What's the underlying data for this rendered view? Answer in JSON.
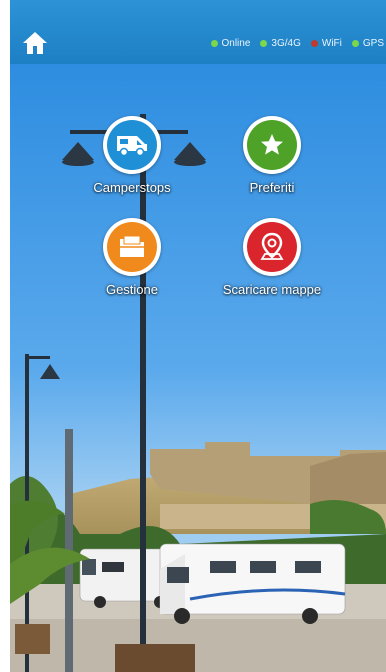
{
  "header": {
    "status": [
      {
        "label": "Online",
        "color": "#7ad84a"
      },
      {
        "label": "3G/4G",
        "color": "#7ad84a"
      },
      {
        "label": "WiFi",
        "color": "#c0392b"
      },
      {
        "label": "GPS",
        "color": "#7ad84a"
      }
    ]
  },
  "menu": {
    "camperstops": {
      "label": "Camperstops",
      "color": "#1f8fd6",
      "icon": "camper-icon"
    },
    "preferiti": {
      "label": "Preferiti",
      "color": "#4ea227",
      "icon": "star-icon"
    },
    "gestione": {
      "label": "Gestione",
      "color": "#f08a1c",
      "icon": "folder-icon"
    },
    "scaricare": {
      "label": "Scaricare mappe",
      "color": "#d9252b",
      "icon": "map-pin-icon"
    }
  }
}
